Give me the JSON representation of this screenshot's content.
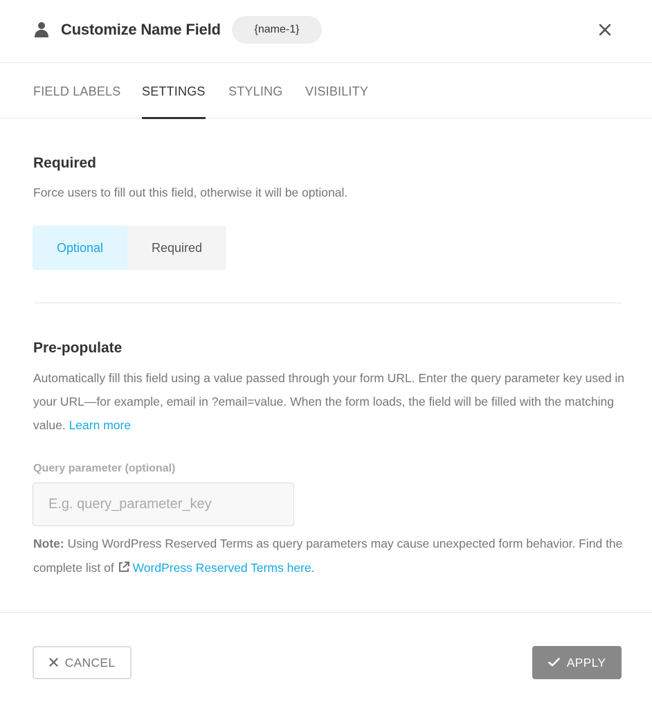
{
  "header": {
    "icon": "user-icon",
    "title": "Customize Name Field",
    "tag": "{name-1}",
    "close_icon": "close-icon"
  },
  "tabs": [
    {
      "label": "FIELD LABELS",
      "active": false
    },
    {
      "label": "SETTINGS",
      "active": true
    },
    {
      "label": "STYLING",
      "active": false
    },
    {
      "label": "VISIBILITY",
      "active": false
    }
  ],
  "required": {
    "title": "Required",
    "description": "Force users to fill out this field, otherwise it will be optional.",
    "options": [
      "Optional",
      "Required"
    ],
    "selected": "Optional"
  },
  "prepopulate": {
    "title": "Pre-populate",
    "description": "Automatically fill this field using a value passed through your form URL. Enter the query parameter key used in your URL—for example, email in ?email=value. When the form loads, the field will be filled with the matching value.",
    "learn_more": "Learn more",
    "field_label": "Query parameter (optional)",
    "field_value": "",
    "field_placeholder": "E.g. query_parameter_key",
    "note_label": "Note:",
    "note_text": "Using WordPress Reserved Terms as query parameters may cause unexpected form behavior. Find the complete list of",
    "note_link": "WordPress Reserved Terms here",
    "note_end": "."
  },
  "footer": {
    "cancel_label": "CANCEL",
    "apply_label": "APPLY"
  },
  "colors": {
    "accent": "#17a8e3",
    "selected_bg": "#e1f6ff",
    "apply_bg": "#888888"
  }
}
